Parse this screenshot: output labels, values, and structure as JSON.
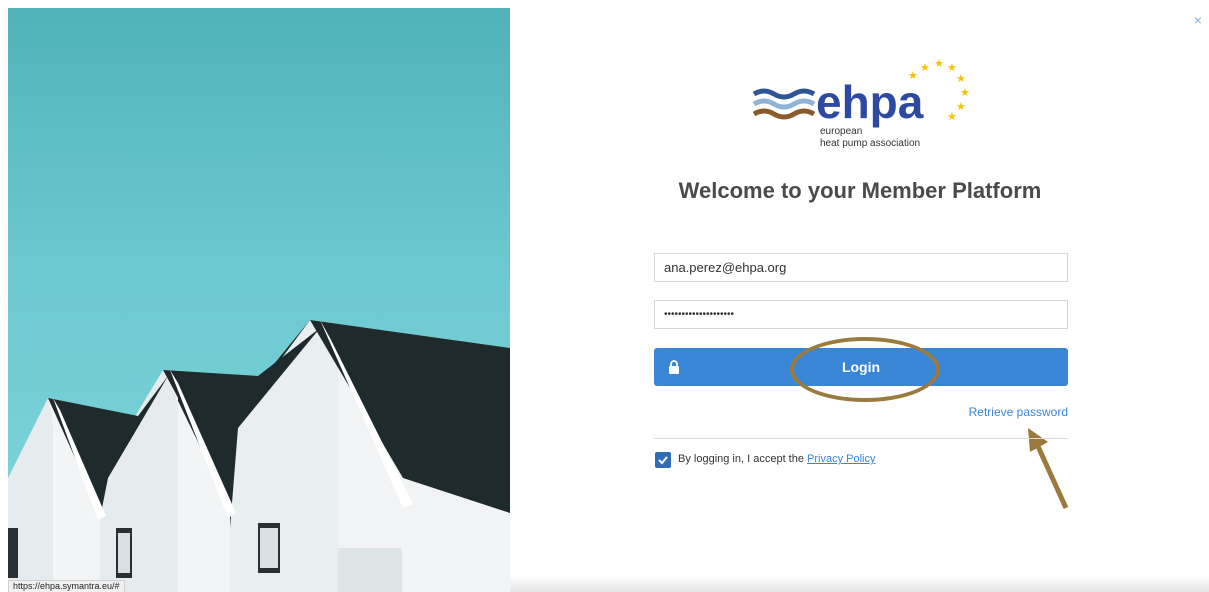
{
  "photo": {
    "alt_icon": "houses-photo"
  },
  "status_bar": {
    "url": "https://ehpa.symantra.eu/#"
  },
  "close": {
    "glyph": "×"
  },
  "logo": {
    "wordmark": "ehpa",
    "line1": "european",
    "line2": "heat pump association"
  },
  "title": "Welcome to your Member Platform",
  "form": {
    "email_value": "ana.perez@ehpa.org",
    "password_mask": "••••••••••••••••••••",
    "login_label": "Login",
    "retrieve_label": "Retrieve password",
    "accept_prefix": "By logging in, I accept the",
    "privacy_link": "Privacy Policy"
  },
  "colors": {
    "primary": "#3a86d6",
    "checkbox": "#2e6db5",
    "annotation": "#9a7a3e"
  }
}
